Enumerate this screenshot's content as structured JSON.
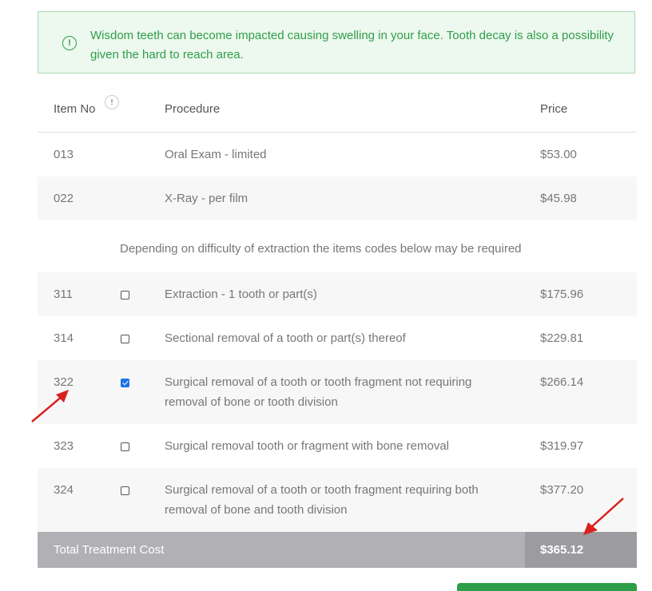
{
  "alert": {
    "icon": "exclamation-circle-icon",
    "text": "Wisdom teeth can become impacted causing swelling in your face. Tooth decay is also a possibility given the hard to reach area."
  },
  "table": {
    "headers": {
      "item_no": "Item No",
      "procedure": "Procedure",
      "price": "Price",
      "info_badge": "!"
    },
    "base_rows": [
      {
        "item": "013",
        "procedure": "Oral Exam - limited",
        "price": "$53.00"
      },
      {
        "item": "022",
        "procedure": "X-Ray - per film",
        "price": "$45.98"
      }
    ],
    "note": "Depending on difficulty of extraction the items codes below may be required",
    "optional_rows": [
      {
        "item": "311",
        "checked": false,
        "procedure": "Extraction - 1 tooth or part(s)",
        "price": "$175.96"
      },
      {
        "item": "314",
        "checked": false,
        "procedure": "Sectional removal of a tooth or part(s) thereof",
        "price": "$229.81"
      },
      {
        "item": "322",
        "checked": true,
        "procedure": "Surgical removal of a tooth or tooth fragment not requiring removal of bone or tooth division",
        "price": "$266.14"
      },
      {
        "item": "323",
        "checked": false,
        "procedure": "Surgical removal tooth or fragment with bone removal",
        "price": "$319.97"
      },
      {
        "item": "324",
        "checked": false,
        "procedure": "Surgical removal of a tooth or tooth fragment requiring both removal of bone and tooth division",
        "price": "$377.20"
      }
    ],
    "total": {
      "label": "Total Treatment Cost",
      "value": "$365.12"
    }
  },
  "colors": {
    "accent_green": "#2e9e49",
    "arrow_red": "#d9211e",
    "checkbox_blue": "#1a73e8"
  }
}
